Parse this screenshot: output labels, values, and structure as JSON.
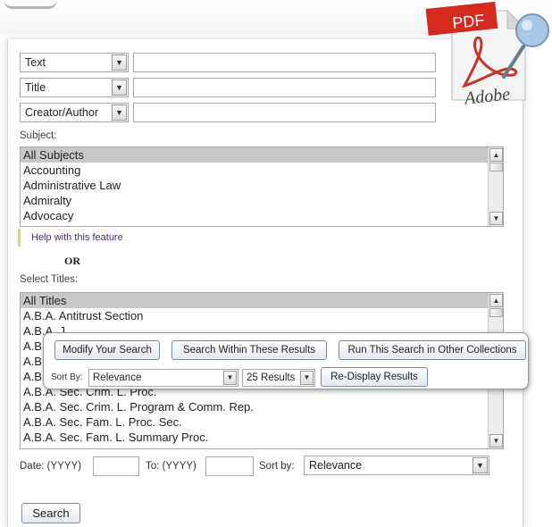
{
  "search_fields": [
    {
      "field": "Text",
      "value": ""
    },
    {
      "field": "Title",
      "value": ""
    },
    {
      "field": "Creator/Author",
      "value": ""
    }
  ],
  "subject": {
    "label": "Subject:",
    "options": [
      "All Subjects",
      "Accounting",
      "Administrative Law",
      "Admiralty",
      "Advocacy"
    ],
    "selected_index": 0,
    "help_link": "Help with this feature"
  },
  "or_label": "OR",
  "titles": {
    "label": "Select Titles:",
    "options": [
      "All Titles",
      "A.B.A. Antitrust Section",
      "A.B.A. J.",
      "A.B",
      "A.B",
      "A.B",
      "A.B.A. Sec. Crim. L. Proc.",
      "A.B.A. Sec. Crim. L. Program & Comm. Rep.",
      "A.B.A. Sec. Fam. L. Proc. Sec.",
      "A.B.A. Sec. Fam. L. Summary Proc."
    ],
    "selected_index": 0
  },
  "popup": {
    "modify_label": "Modify Your Search",
    "within_label": "Search Within These Results",
    "other_collections_label": "Run This Search in Other Collections",
    "sort_by_label": "Sort By:",
    "sort_value": "Relevance",
    "results_value": "25 Results",
    "redisplay_label": "Re-Display Results"
  },
  "date": {
    "from_label": "Date: (YYYY)",
    "from_value": "",
    "to_label": "To: (YYYY)",
    "to_value": "",
    "sort_label": "Sort by:",
    "sort_value": "Relevance"
  },
  "search_button": "Search",
  "pdf_icon": {
    "badge_text": "PDF",
    "brand_text": "Adobe",
    "badge_color": "#d42a1e",
    "magnifier_color": "#5a8cc0",
    "name": "pdf-magnifier-icon"
  }
}
